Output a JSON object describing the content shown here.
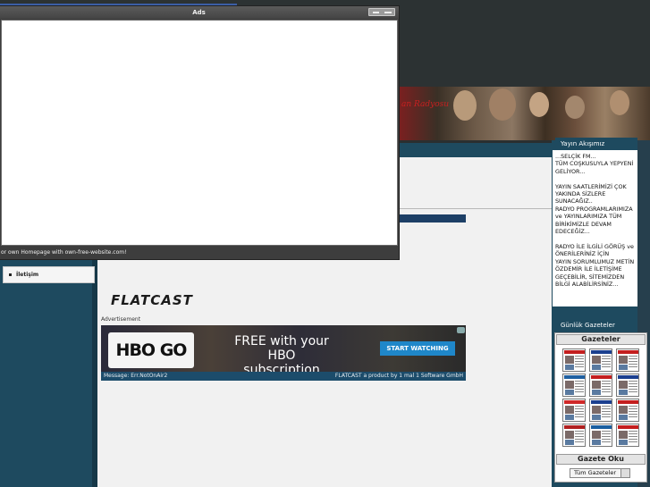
{
  "popup": {
    "title": "Ads",
    "footer_text": "or own Homepage with own-free-website.com!"
  },
  "banner": {
    "title": "an Radyosu"
  },
  "nav": {
    "items": [
      {
        "label": "İletişim"
      }
    ]
  },
  "main": {
    "logo_text": "FLATCAST",
    "ad_label": "Advertisement",
    "ad": {
      "logo": "HBO GO",
      "headline": "FREE with your HBO subscription",
      "button_label": "START WATCHING"
    },
    "message_left": "Message: Err.NotOnAir2",
    "message_right": "FLATCAST a product by 1 mal 1 Software GmbH"
  },
  "sidebar": {
    "broadcast_title": "Yayın Akışımız",
    "broadcast_text": "...SELÇİK FM...\nTÜM COŞKUSUYLA YEPYENİ GELİYOR...\n\nYAYIN SAATLERİMİZİ ÇOK YAKINDA SİZLERE SUNACAĞIZ..\nRADYO PROGRAMLARIMIZA ve YAYINLARIMIZA TÜM BİRİKİMİZLE DEVAM EDECEĞİZ...\n\nRADYO İLE İLGİLİ GÖRÜŞ ve ÖNERİLERİNİZ İÇİN\nYAYIN SORUMLUMUZ METİN ÖZDEMİR İLE İLETİŞİME GEÇEBİLİR, SİTEMİZDEN BİLGİ ALABİLİRSİNİZ...",
    "newspapers_title": "Günlük Gazeteler",
    "newspapers_header": "Gazeteler",
    "read_header": "Gazete Oku",
    "select_value": "Tüm Gazeteler"
  },
  "colors": {
    "sidebar_bg": "#1e4a5f",
    "main_bg": "#f1f1f1",
    "accent_blue": "#1f87c9",
    "message_bar": "#1c4c6b"
  }
}
